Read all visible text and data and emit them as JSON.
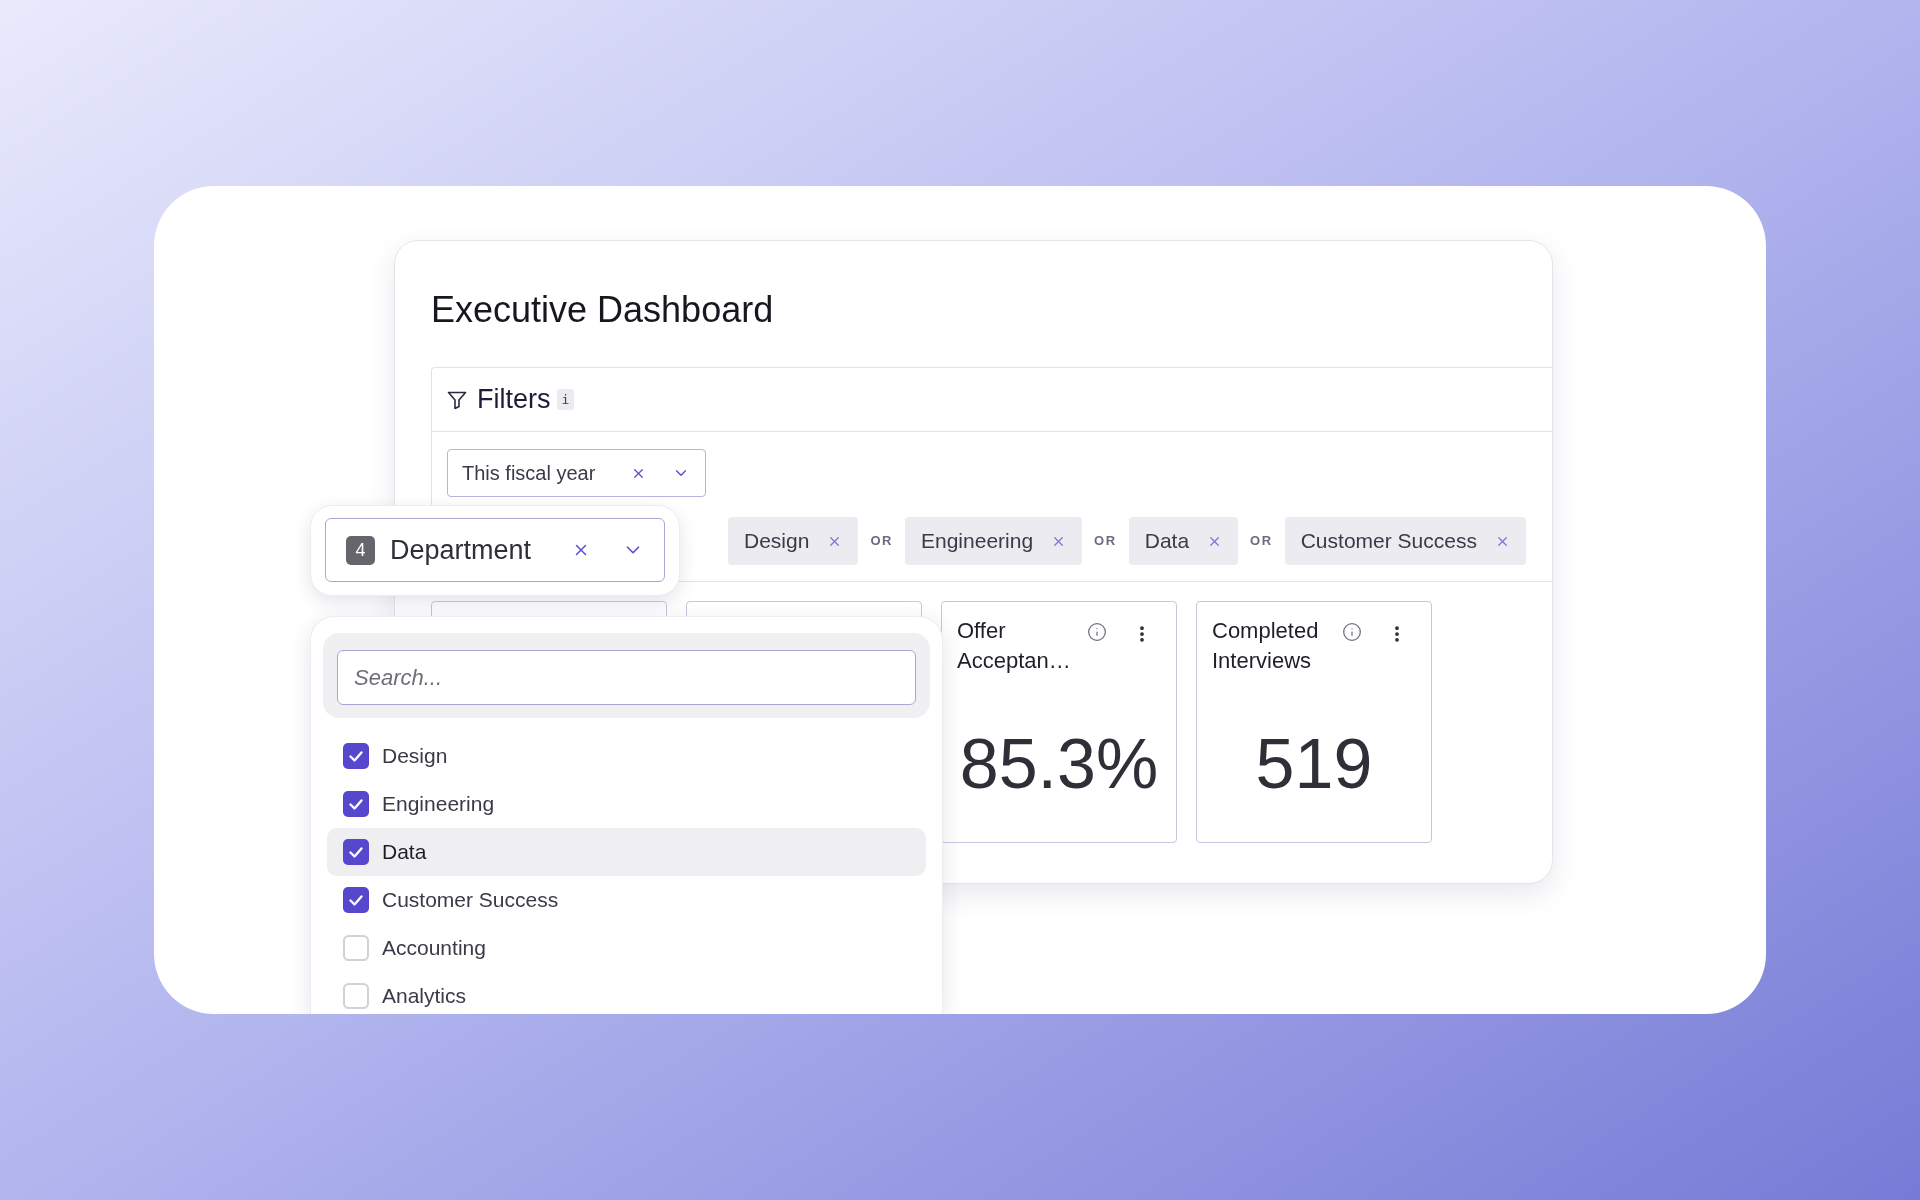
{
  "dashboard": {
    "title": "Executive Dashboard",
    "filters": {
      "heading": "Filters",
      "info_hint": "i",
      "date_filter": {
        "value": "This fiscal year"
      },
      "department_filter": {
        "count": "4",
        "label": "Department",
        "chips": [
          {
            "label": "Design"
          },
          {
            "joiner": "OR",
            "label": "Engineering"
          },
          {
            "joiner": "OR",
            "label": "Data"
          },
          {
            "joiner": "OR",
            "label": "Customer Success"
          }
        ]
      }
    },
    "metrics": [
      {
        "title": "Offer Acceptan…",
        "value": "85.3%"
      },
      {
        "title": "Completed Interviews",
        "value": "519"
      }
    ]
  },
  "department_dropdown": {
    "search": {
      "placeholder": "Search..."
    },
    "options": [
      {
        "label": "Design",
        "checked": true,
        "highlighted": false
      },
      {
        "label": "Engineering",
        "checked": true,
        "highlighted": false
      },
      {
        "label": "Data",
        "checked": true,
        "highlighted": true
      },
      {
        "label": "Customer Success",
        "checked": true,
        "highlighted": false
      },
      {
        "label": "Accounting",
        "checked": false,
        "highlighted": false
      },
      {
        "label": "Analytics",
        "checked": false,
        "highlighted": false
      }
    ]
  }
}
